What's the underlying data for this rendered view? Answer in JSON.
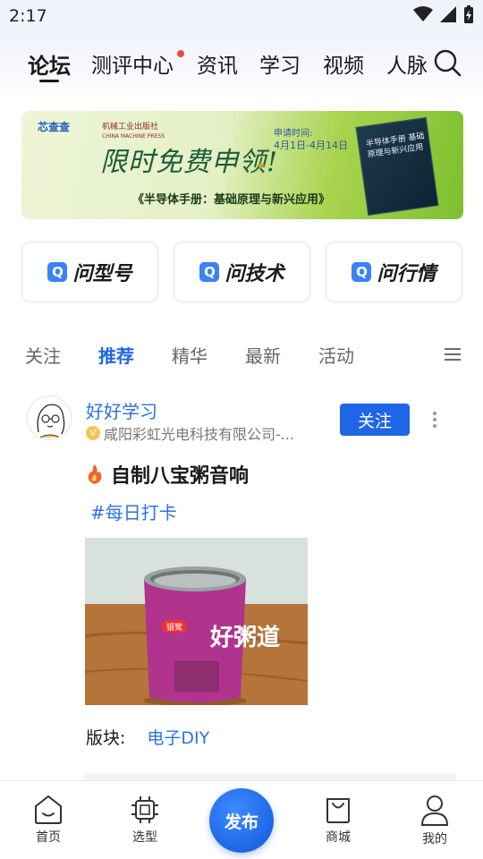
{
  "status_bar": {
    "time": "2:17"
  },
  "top_nav": {
    "tabs": [
      {
        "label": "论坛",
        "active": true
      },
      {
        "label": "测评中心",
        "has_dot": true
      },
      {
        "label": "资讯"
      },
      {
        "label": "学习"
      },
      {
        "label": "视频"
      },
      {
        "label": "人脉"
      }
    ],
    "search_icon": "search-icon"
  },
  "banner": {
    "logo1": "芯查查",
    "logo2": "机械工业出版社",
    "logo2_sub": "CHINA MACHINE PRESS",
    "headline": "限时免费申领!",
    "apply_label": "申请时间:",
    "apply_dates": "4月1日-4月14日",
    "subtitle": "《半导体手册：基础原理与新兴应用》",
    "book_title": "半导体手册 基础原理与新兴应用"
  },
  "quick_buttons": [
    {
      "label": "问型号",
      "icon": "q-icon"
    },
    {
      "label": "问技术",
      "icon": "q-icon"
    },
    {
      "label": "问行情",
      "icon": "q-icon"
    }
  ],
  "sub_tabs": [
    {
      "label": "关注"
    },
    {
      "label": "推荐",
      "active": true
    },
    {
      "label": "精华"
    },
    {
      "label": "最新"
    },
    {
      "label": "活动"
    }
  ],
  "post": {
    "username": "好好学习",
    "company": "咸阳彩虹光电科技有限公司-...",
    "follow_label": "关注",
    "title": "自制八宝粥音响",
    "hashtag": "#每日打卡",
    "section_label": "版块:",
    "section_value": "电子DIY",
    "can_brand": "好粥道",
    "can_logo": "银鹭"
  },
  "bottom_nav": {
    "items": [
      {
        "label": "首页",
        "icon": "home-icon"
      },
      {
        "label": "选型",
        "icon": "chip-icon"
      },
      {
        "label": "发布",
        "icon": "publish-button"
      },
      {
        "label": "商城",
        "icon": "shopping-bag-icon"
      },
      {
        "label": "我的",
        "icon": "profile-icon"
      }
    ]
  },
  "colors": {
    "accent": "#1f66e6",
    "link": "#2c73df",
    "badge_dot": "#f2453d"
  }
}
